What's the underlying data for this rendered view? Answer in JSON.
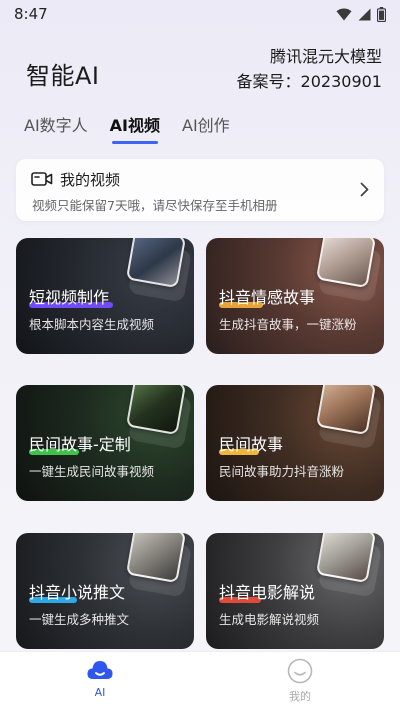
{
  "status_bar": {
    "time": "8:47"
  },
  "header": {
    "app_title": "智能AI",
    "model_name": "腾讯混元大模型",
    "filing_number": "备案号：20230901"
  },
  "tabs": [
    {
      "label": "AI数字人",
      "active": false
    },
    {
      "label": "AI视频",
      "active": true
    },
    {
      "label": "AI创作",
      "active": false
    }
  ],
  "my_video": {
    "title": "我的视频",
    "subtitle": "视频只能保留7天哦，请尽快保存至手机相册"
  },
  "feature_cards": [
    {
      "title": "短视频制作",
      "subtitle": "根本脚本内容生成视频",
      "accent_color": "#6f4cf6"
    },
    {
      "title": "抖音情感故事",
      "subtitle": "生成抖音故事，一键涨粉",
      "accent_color": "#e8a23a"
    },
    {
      "title": "民间故事-定制",
      "subtitle": "一键生成民间故事视频",
      "accent_color": "#3ec24a"
    },
    {
      "title": "民间故事",
      "subtitle": "民间故事助力抖音涨粉",
      "accent_color": "#f0b63a"
    },
    {
      "title": "抖音小说推文",
      "subtitle": "一键生成多种推文",
      "accent_color": "#2fa8e8"
    },
    {
      "title": "抖音电影解说",
      "subtitle": "生成电影解说视频",
      "accent_color": "#e04a3a"
    }
  ],
  "bottom_nav": [
    {
      "label": "AI",
      "icon": "cloud-icon",
      "active": true,
      "color": "#2f57ef"
    },
    {
      "label": "我的",
      "icon": "smiley-icon",
      "active": false,
      "color": "#aaaaaa"
    }
  ]
}
